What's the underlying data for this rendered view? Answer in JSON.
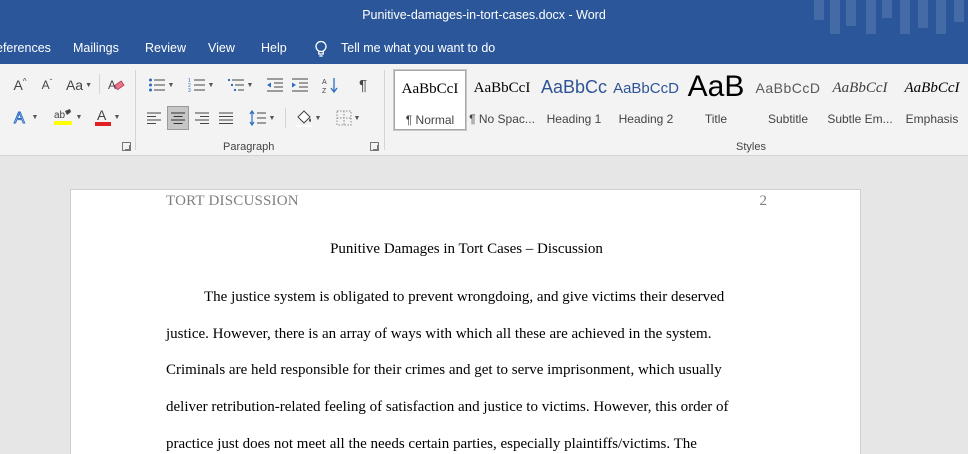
{
  "window": {
    "title": "Punitive-damages-in-tort-cases.docx  -  Word"
  },
  "menu": {
    "tabs": [
      "eferences",
      "Mailings",
      "Review",
      "View",
      "Help"
    ],
    "tell_me": "Tell me what you want to do"
  },
  "ribbon": {
    "font_group": {
      "change_case": "Aa"
    },
    "paragraph_group": {
      "label": "Paragraph"
    },
    "styles_group": {
      "label": "Styles",
      "items": [
        {
          "preview": "AaBbCcI",
          "name": "¶ Normal",
          "selected": true
        },
        {
          "preview": "AaBbCcI",
          "name": "¶ No Spac..."
        },
        {
          "preview": "AaBbCc",
          "name": "Heading 1"
        },
        {
          "preview": "AaBbCcD",
          "name": "Heading 2"
        },
        {
          "preview": "AaB",
          "name": "Title"
        },
        {
          "preview": "AaBbCcD",
          "name": "Subtitle"
        },
        {
          "preview": "AaBbCcI",
          "name": "Subtle Em..."
        },
        {
          "preview": "AaBbCcI",
          "name": "Emphasis"
        }
      ]
    },
    "colors": {
      "highlight": "#ffff00",
      "font_color": "#e02020",
      "accent": "#2b579a"
    }
  },
  "document": {
    "header_left": "TORT DISCUSSION",
    "header_right": "2",
    "title": "Punitive Damages in Tort Cases – Discussion",
    "lines": [
      "The justice system is obligated to prevent wrongdoing, and give victims their deserved",
      "justice. However, there is an array of ways with which all these are achieved in the system.",
      "Criminals are held responsible for their crimes and get to serve imprisonment, which usually",
      "deliver retribution-related feeling of satisfaction and justice to victims. However, this order of",
      "practice just does not meet all the needs certain parties, especially plaintiffs/victims. The"
    ]
  }
}
